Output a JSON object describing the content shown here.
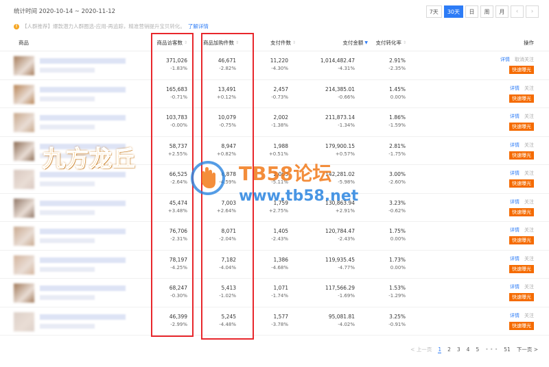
{
  "header": {
    "stat_label": "统计时间 2020-10-14 ~ 2020-11-12",
    "periods": [
      "7天",
      "30天",
      "日",
      "周",
      "月"
    ],
    "active_period": "30天",
    "prev_icon": "chevron-left-icon",
    "next_icon": "chevron-right-icon"
  },
  "tip": {
    "icon": "info-icon",
    "text": "【人群推荐】爆款潜力人群圈选-应用-再追踪，精准营销提升宝贝转化。",
    "link": "了解详情"
  },
  "columns": {
    "product": "商品",
    "visitors": "商品访客数",
    "cart": "商品加购件数",
    "pay_items": "支付件数",
    "pay_amount": "支付金额",
    "conversion": "支付转化率",
    "actions": "操作"
  },
  "actions": {
    "detail": "详情",
    "unfollow": "取消关注",
    "follow": "关注",
    "expose": "快速曝光"
  },
  "rows": [
    {
      "visitors": "371,026",
      "visitors_pct": "-1.83%",
      "cart": "46,671",
      "cart_pct": "-2.82%",
      "items": "11,220",
      "items_pct": "-4.30%",
      "amount": "1,014,482.47",
      "amount_pct": "-4.31%",
      "conv": "2.91%",
      "conv_pct": "-2.35%",
      "follow": "取消关注",
      "thumb_color": "#a47a58"
    },
    {
      "visitors": "165,683",
      "visitors_pct": "-0.71%",
      "cart": "13,491",
      "cart_pct": "+0.12%",
      "items": "2,457",
      "items_pct": "-0.73%",
      "amount": "214,385.01",
      "amount_pct": "-0.66%",
      "conv": "1.45%",
      "conv_pct": "0.00%",
      "follow": "关注",
      "thumb_color": "#b88456"
    },
    {
      "visitors": "103,783",
      "visitors_pct": "-0.00%",
      "cart": "10,079",
      "cart_pct": "-0.75%",
      "items": "2,002",
      "items_pct": "-1.38%",
      "amount": "211,873.14",
      "amount_pct": "-1.34%",
      "conv": "1.86%",
      "conv_pct": "-1.59%",
      "follow": "关注",
      "thumb_color": "#c8a78a"
    },
    {
      "visitors": "58,737",
      "visitors_pct": "+2.55%",
      "cart": "8,947",
      "cart_pct": "+0.82%",
      "items": "1,988",
      "items_pct": "+0.51%",
      "amount": "179,900.15",
      "amount_pct": "+0.57%",
      "conv": "2.81%",
      "conv_pct": "-1.75%",
      "follow": "关注",
      "thumb_color": "#8a6a52"
    },
    {
      "visitors": "66,525",
      "visitors_pct": "-2.64%",
      "cart": "6,878",
      "cart_pct": "-4.59%",
      "items": "2,063",
      "items_pct": "-5.11%",
      "amount": "142,281.02",
      "amount_pct": "-5.98%",
      "conv": "3.00%",
      "conv_pct": "-2.60%",
      "follow": "关注",
      "thumb_color": "#d9c8c0"
    },
    {
      "visitors": "45,474",
      "visitors_pct": "+3.48%",
      "cart": "7,003",
      "cart_pct": "+2.64%",
      "items": "1,759",
      "items_pct": "+2.75%",
      "amount": "130,863.94",
      "amount_pct": "+2.91%",
      "conv": "3.23%",
      "conv_pct": "-0.62%",
      "follow": "关注",
      "thumb_color": "#8f7565"
    },
    {
      "visitors": "76,706",
      "visitors_pct": "-2.31%",
      "cart": "8,071",
      "cart_pct": "-2.04%",
      "items": "1,405",
      "items_pct": "-2.43%",
      "amount": "120,784.47",
      "amount_pct": "-2.43%",
      "conv": "1.75%",
      "conv_pct": "0.00%",
      "follow": "关注",
      "thumb_color": "#c9a98f"
    },
    {
      "visitors": "78,197",
      "visitors_pct": "-4.25%",
      "cart": "7,182",
      "cart_pct": "-4.04%",
      "items": "1,386",
      "items_pct": "-4.68%",
      "amount": "119,935.45",
      "amount_pct": "-4.77%",
      "conv": "1.73%",
      "conv_pct": "0.00%",
      "follow": "关注",
      "thumb_color": "#d4b49c"
    },
    {
      "visitors": "68,247",
      "visitors_pct": "-0.30%",
      "cart": "5,413",
      "cart_pct": "-1.02%",
      "items": "1,071",
      "items_pct": "-1.74%",
      "amount": "117,566.29",
      "amount_pct": "-1.69%",
      "conv": "1.53%",
      "conv_pct": "-1.29%",
      "follow": "关注",
      "thumb_color": "#a07858"
    },
    {
      "visitors": "46,399",
      "visitors_pct": "-2.99%",
      "cart": "5,245",
      "cart_pct": "-4.48%",
      "items": "1,577",
      "items_pct": "-3.78%",
      "amount": "95,081.81",
      "amount_pct": "-4.02%",
      "conv": "3.25%",
      "conv_pct": "-0.91%",
      "follow": "关注",
      "thumb_color": "#ddd0c8"
    }
  ],
  "pager": {
    "prev": "< 上一页",
    "pages": [
      "1",
      "2",
      "3",
      "4",
      "5"
    ],
    "current": "1",
    "ellipsis": "• • •",
    "last": "51",
    "next": "下一页 >"
  },
  "watermark": {
    "left_text": "九方龙丘",
    "title": "TB58论坛",
    "url": "www.tb58.net"
  },
  "colors": {
    "accent": "#2d7cf6",
    "expose": "#f56b00",
    "highlight_box": "#e8262b"
  }
}
